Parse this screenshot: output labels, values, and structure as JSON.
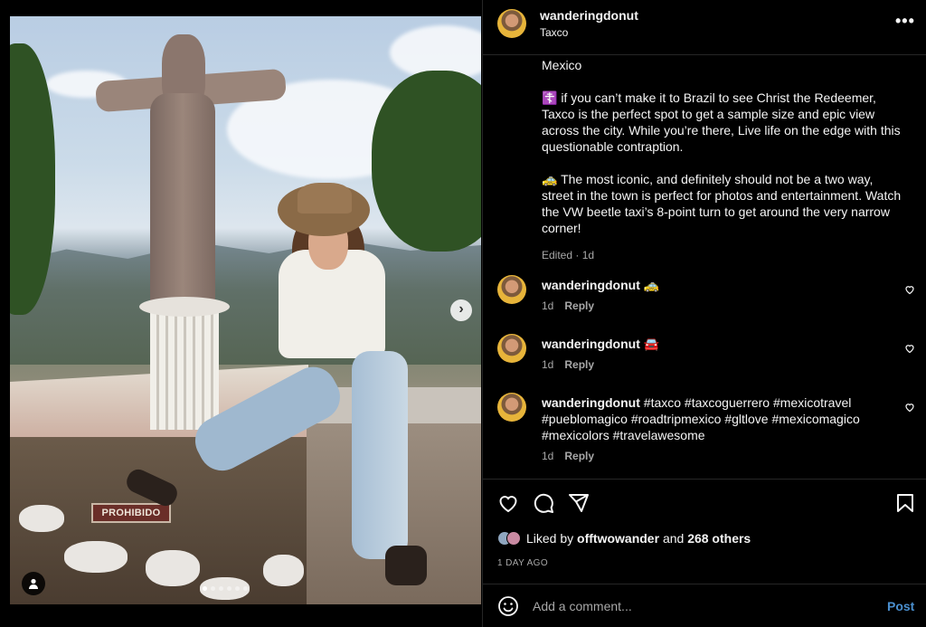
{
  "post": {
    "username": "wanderingdonut",
    "location": "Taxco",
    "more_label": "•••",
    "image_sign_text": "PROHIBIDO",
    "carousel": {
      "dot_count": 6,
      "active_index": 0
    },
    "caption": {
      "p1": "Mexico",
      "p2": "☦️ if you can’t make it to Brazil to see Christ the Redeemer, Taxco is the perfect spot to get a sample size and epic view across the city. While you’re there, Live life on the edge with this questionable contraption.",
      "p3": "🚕 The most iconic, and definitely should not be a two way, street in the town is perfect for photos and entertainment. Watch the VW beetle taxi’s 8-point turn to get around the very narrow corner!",
      "edited": "Edited · 1d"
    },
    "comments": [
      {
        "username": "wanderingdonut",
        "text": "🚕",
        "age": "1d",
        "reply": "Reply"
      },
      {
        "username": "wanderingdonut",
        "text": "🚘",
        "age": "1d",
        "reply": "Reply"
      },
      {
        "username": "wanderingdonut",
        "text": "#taxco #taxcoguerrero #mexicotravel #pueblomagico #roadtripmexico #gltlove #mexicomagico #mexicolors #travelawesome",
        "age": "1d",
        "reply": "Reply"
      }
    ],
    "likes": {
      "prefix": "Liked by",
      "user": "offtwowander",
      "and": "and",
      "others": "268 others"
    },
    "timestamp": "1 DAY AGO",
    "add_comment": {
      "placeholder": "Add a comment...",
      "post_label": "Post"
    }
  },
  "icons": [
    "more-icon",
    "chevron-right-icon",
    "user-tag-icon",
    "heart-icon",
    "comment-icon",
    "share-icon",
    "bookmark-icon",
    "emoji-icon"
  ],
  "colors": {
    "background": "#000000",
    "text": "#f5f5f5",
    "muted": "#a8a8a8",
    "link": "#4a8fcf",
    "avatar_ring": "#e7b43a"
  }
}
